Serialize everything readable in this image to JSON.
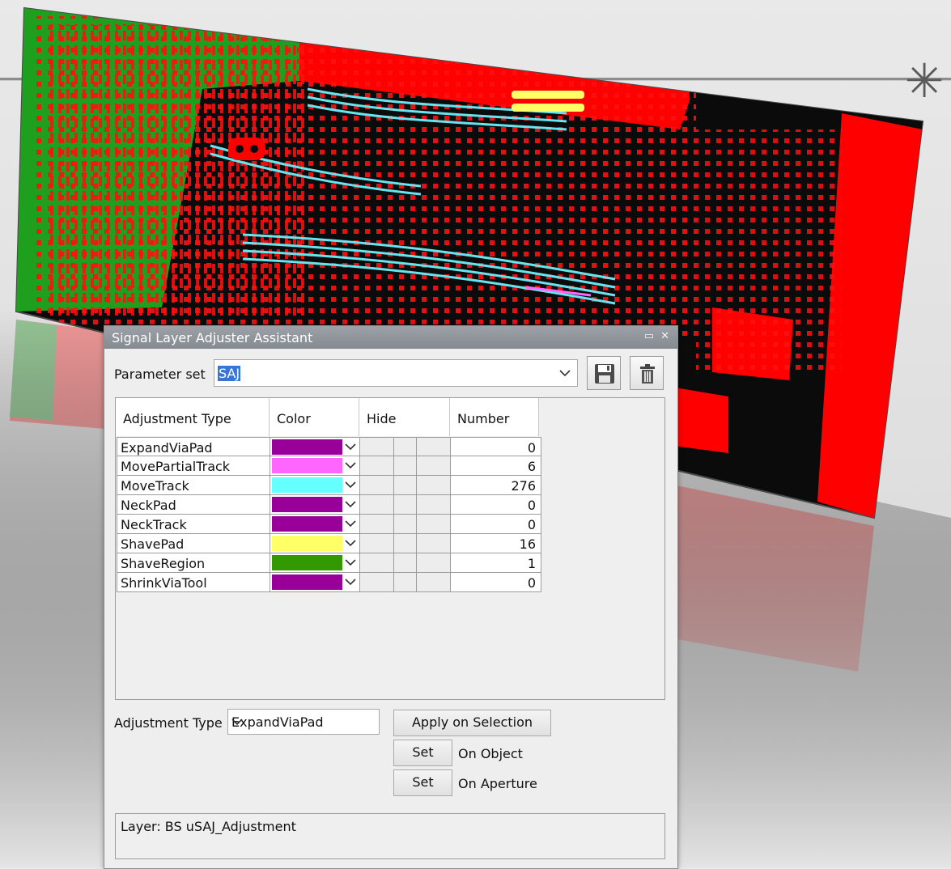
{
  "dialog": {
    "title": "Signal Layer Adjuster Assistant",
    "window_icons": "▭ ✕",
    "parameter_set_label": "Parameter set",
    "parameter_set_value": "SAJ",
    "save_icon": "floppy-disk-icon",
    "delete_icon": "trash-icon"
  },
  "table": {
    "headers": [
      "Adjustment Type",
      "Color",
      "Hide",
      "Number"
    ],
    "rows": [
      {
        "type": "ExpandViaPad",
        "color": "#990099",
        "number": "0"
      },
      {
        "type": "MovePartialTrack",
        "color": "#ff66ff",
        "number": "6"
      },
      {
        "type": "MoveTrack",
        "color": "#66ffff",
        "number": "276"
      },
      {
        "type": "NeckPad",
        "color": "#990099",
        "number": "0"
      },
      {
        "type": "NeckTrack",
        "color": "#990099",
        "number": "0"
      },
      {
        "type": "ShavePad",
        "color": "#ffff66",
        "number": "16"
      },
      {
        "type": "ShaveRegion",
        "color": "#339900",
        "number": "1"
      },
      {
        "type": "ShrinkViaTool",
        "color": "#990099",
        "number": "0"
      }
    ]
  },
  "controls": {
    "adjustment_type_label": "Adjustment Type",
    "adjustment_type_value": "ExpandViaPad",
    "apply_label": "Apply on Selection",
    "set_object_label": "Set",
    "on_object_label": "On Object",
    "set_aperture_label": "Set",
    "on_aperture_label": "On Aperture"
  },
  "status": {
    "text": "Layer: BS uSAJ_Adjustment"
  },
  "colors": {
    "pcb_red": "#ff0000",
    "pcb_green": "#1ea01e",
    "pcb_black": "#0a0a0a",
    "trace_cyan": "#66e5ee"
  }
}
